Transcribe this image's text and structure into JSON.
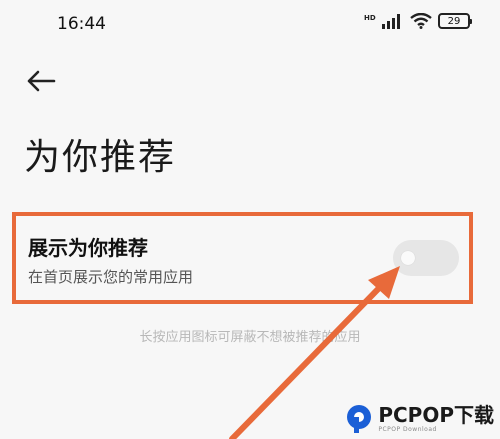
{
  "status_bar": {
    "time": "16:44",
    "battery": "29",
    "icons": [
      "hd-icon",
      "signal-icon",
      "wifi-icon",
      "battery-icon"
    ]
  },
  "page": {
    "title": "为你推荐"
  },
  "setting": {
    "title": "展示为你推荐",
    "subtitle": "在首页展示您的常用应用",
    "toggle_on": false
  },
  "hint": "长按应用图标可屏蔽不想被推荐的应用",
  "watermark": {
    "main": "PCPOP下载",
    "sub": "PCPOP Download"
  },
  "colors": {
    "highlight": "#e86a3a",
    "toggle_off": "#e6e6e6",
    "background": "#f7f7f7"
  }
}
